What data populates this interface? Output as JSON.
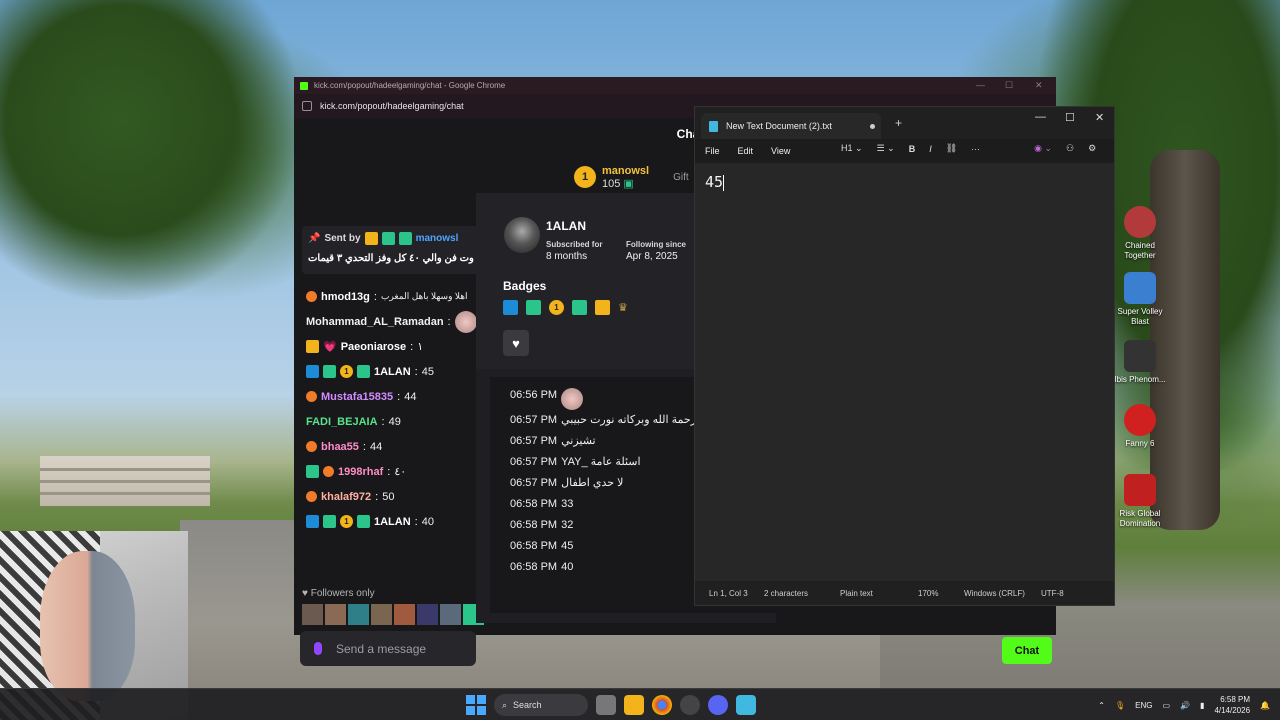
{
  "chrome": {
    "title": "kick.com/popout/hadeelgaming/chat - Google Chrome",
    "address": "kick.com/popout/hadeelgaming/chat"
  },
  "chat": {
    "header": "Chat",
    "gift_top": {
      "rank": "1",
      "name": "manowsl",
      "count": "105",
      "gift_label": "Gift"
    },
    "pinned": {
      "sent_by": "Sent by",
      "user": "manowsl",
      "text": "وت فن والي ٤٠ كل وفز التحدي ٣ قيمات"
    },
    "messages": [
      {
        "user": "hmod13g",
        "color": "#f0f0f0",
        "text": "اهلا وسهلا باهل المغرب"
      },
      {
        "user": "Mohammad_AL_Ramadan",
        "color": "#f0f0f0",
        "text": ""
      },
      {
        "user": "Paeoniarose",
        "color": "#f0f0f0",
        "text": "١"
      },
      {
        "user": "1ALAN",
        "color": "#f0f0f0",
        "text": "45"
      },
      {
        "user": "Mustafa15835",
        "color": "#d28cff",
        "text": "44"
      },
      {
        "user": "FADI_BEJAIA",
        "color": "#57e389",
        "text": "49"
      },
      {
        "user": "bhaa55",
        "color": "#ff8cc6",
        "text": "44"
      },
      {
        "user": "1998rhaf",
        "color": "#ff8cc6",
        "text": "٤٠"
      },
      {
        "user": "khalaf972",
        "color": "#ffb0a0",
        "text": "50"
      },
      {
        "user": "1ALAN",
        "color": "#f0f0f0",
        "text": "40"
      }
    ],
    "followers_only": "Followers only",
    "send_placeholder": "Send a message",
    "chat_button": "Chat"
  },
  "usercard": {
    "username": "1ALAN",
    "subscribed_label": "Subscribed for",
    "subscribed_value": "8 months",
    "following_label": "Following since",
    "following_value": "Apr 8, 2025",
    "badges_heading": "Badges",
    "history": [
      {
        "time": "06:56 PM",
        "text": ""
      },
      {
        "time": "06:57 PM",
        "text": "السلام ورحمة الله وبركاته نورت حبيبي"
      },
      {
        "time": "06:57 PM",
        "text": "تشيزني"
      },
      {
        "time": "06:57 PM",
        "text": "اسئلة عامة _YAY"
      },
      {
        "time": "06:57 PM",
        "text": "لا حدي اطفال"
      },
      {
        "time": "06:58 PM",
        "text": "33"
      },
      {
        "time": "06:58 PM",
        "text": "32"
      },
      {
        "time": "06:58 PM",
        "text": "45"
      },
      {
        "time": "06:58 PM",
        "text": "40"
      }
    ]
  },
  "notepad": {
    "tab_title": "New Text Document (2).txt",
    "menu": [
      "File",
      "Edit",
      "View"
    ],
    "heading_select": "H1",
    "content": "45",
    "status": {
      "position": "Ln 1, Col 3",
      "chars": "2 characters",
      "format": "Plain text",
      "zoom": "170%",
      "line_ending": "Windows (CRLF)",
      "encoding": "UTF-8"
    }
  },
  "desktop_icons": [
    {
      "label": "Chained Together",
      "color": "#b33a3a"
    },
    {
      "label": "Super Volley Blast",
      "color": "#3a7fd0"
    },
    {
      "label": "Ibis Phenom...",
      "color": "#333333"
    },
    {
      "label": "Fanny 6",
      "color": "#d02020"
    },
    {
      "label": "Risk Global Domination",
      "color": "#c02020"
    }
  ],
  "taskbar": {
    "search": "Search",
    "lang": "ENG",
    "time": "6:58 PM",
    "date": "4/14/2026"
  }
}
